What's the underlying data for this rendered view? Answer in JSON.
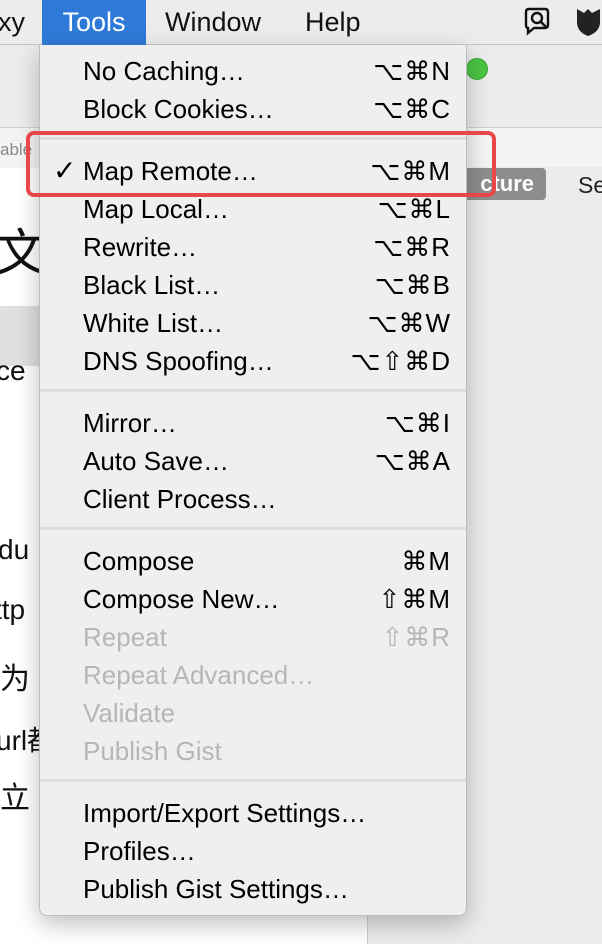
{
  "menubar": {
    "items": [
      {
        "label": "xy"
      },
      {
        "label": "Tools"
      },
      {
        "label": "Window"
      },
      {
        "label": "Help"
      }
    ],
    "icons": [
      "search-chat-icon",
      "shield-icon"
    ]
  },
  "background": {
    "address_text": "able",
    "segment_button": "cture",
    "segment_label": "Se",
    "text_fragments": [
      "文",
      "ce",
      "du",
      "ttp",
      "为",
      "url都",
      "立"
    ]
  },
  "menu": {
    "groups": [
      [
        {
          "label": "No Caching…",
          "shortcut": "⌥⌘N",
          "checked": false,
          "enabled": true
        },
        {
          "label": "Block Cookies…",
          "shortcut": "⌥⌘C",
          "checked": false,
          "enabled": true
        }
      ],
      [
        {
          "label": "Map Remote…",
          "shortcut": "⌥⌘M",
          "checked": true,
          "enabled": true
        },
        {
          "label": "Map Local…",
          "shortcut": "⌥⌘L",
          "checked": false,
          "enabled": true
        },
        {
          "label": "Rewrite…",
          "shortcut": "⌥⌘R",
          "checked": false,
          "enabled": true
        },
        {
          "label": "Black List…",
          "shortcut": "⌥⌘B",
          "checked": false,
          "enabled": true
        },
        {
          "label": "White List…",
          "shortcut": "⌥⌘W",
          "checked": false,
          "enabled": true
        },
        {
          "label": "DNS Spoofing…",
          "shortcut": "⌥⇧⌘D",
          "checked": false,
          "enabled": true
        }
      ],
      [
        {
          "label": "Mirror…",
          "shortcut": "⌥⌘I",
          "checked": false,
          "enabled": true
        },
        {
          "label": "Auto Save…",
          "shortcut": "⌥⌘A",
          "checked": false,
          "enabled": true
        },
        {
          "label": "Client Process…",
          "shortcut": "",
          "checked": false,
          "enabled": true
        }
      ],
      [
        {
          "label": "Compose",
          "shortcut": "⌘M",
          "checked": false,
          "enabled": true
        },
        {
          "label": "Compose New…",
          "shortcut": "⇧⌘M",
          "checked": false,
          "enabled": true
        },
        {
          "label": "Repeat",
          "shortcut": "⇧⌘R",
          "checked": false,
          "enabled": false
        },
        {
          "label": "Repeat Advanced…",
          "shortcut": "",
          "checked": false,
          "enabled": false
        },
        {
          "label": "Validate",
          "shortcut": "",
          "checked": false,
          "enabled": false
        },
        {
          "label": "Publish Gist",
          "shortcut": "",
          "checked": false,
          "enabled": false
        }
      ],
      [
        {
          "label": "Import/Export Settings…",
          "shortcut": "",
          "checked": false,
          "enabled": true
        },
        {
          "label": "Profiles…",
          "shortcut": "",
          "checked": false,
          "enabled": true
        },
        {
          "label": "Publish Gist Settings…",
          "shortcut": "",
          "checked": false,
          "enabled": true
        }
      ]
    ],
    "check_glyph": "✓"
  },
  "colors": {
    "menubar_active": "#2f7ad8",
    "highlight_box": "#e8474a",
    "disabled_text": "#b6b6b6"
  }
}
